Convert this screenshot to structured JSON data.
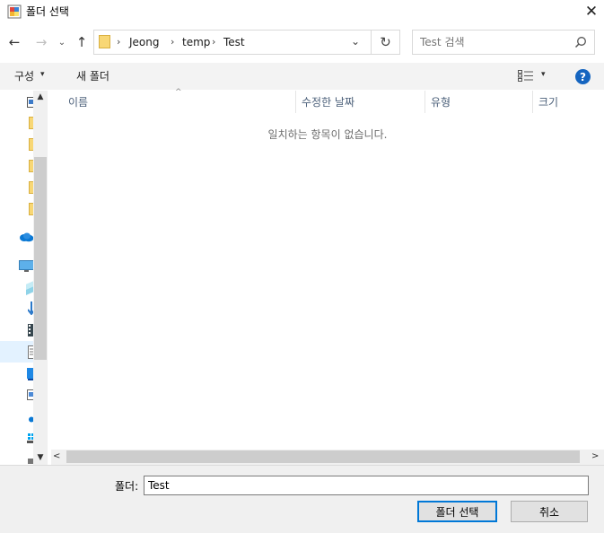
{
  "window": {
    "title": "폴더 선택",
    "close_glyph": "✕",
    "icon": "app-window-icon"
  },
  "nav": {
    "back_glyph": "←",
    "forward_glyph": "→",
    "recent_glyph": "⌄",
    "up_glyph": "↑",
    "breadcrumb_sep": "›",
    "breadcrumb": [
      "Jeong",
      "temp",
      "Test"
    ],
    "dropdown_glyph": "⌄",
    "refresh_glyph": "↻"
  },
  "search": {
    "placeholder": "Test 검색",
    "value": ""
  },
  "commandbar": {
    "organize_label": "구성",
    "caret": "▾",
    "new_folder_label": "새 폴더",
    "help_glyph": "?"
  },
  "columns": [
    "이름",
    "수정한 날짜",
    "유형",
    "크기"
  ],
  "sort_glyph": "^",
  "empty_message": "일치하는 항목이 없습니다.",
  "scroll": {
    "up": "▲",
    "down": "▼",
    "left": "<",
    "right": ">"
  },
  "bottom": {
    "folder_label": "폴더:",
    "folder_value": "Test",
    "select_button": "폴더 선택",
    "cancel_button": "취소"
  },
  "colors": {
    "accent": "#0078d7",
    "help_icon": "#1565c0",
    "folder": "#f8d775",
    "onedrive": "#0a78d4"
  }
}
